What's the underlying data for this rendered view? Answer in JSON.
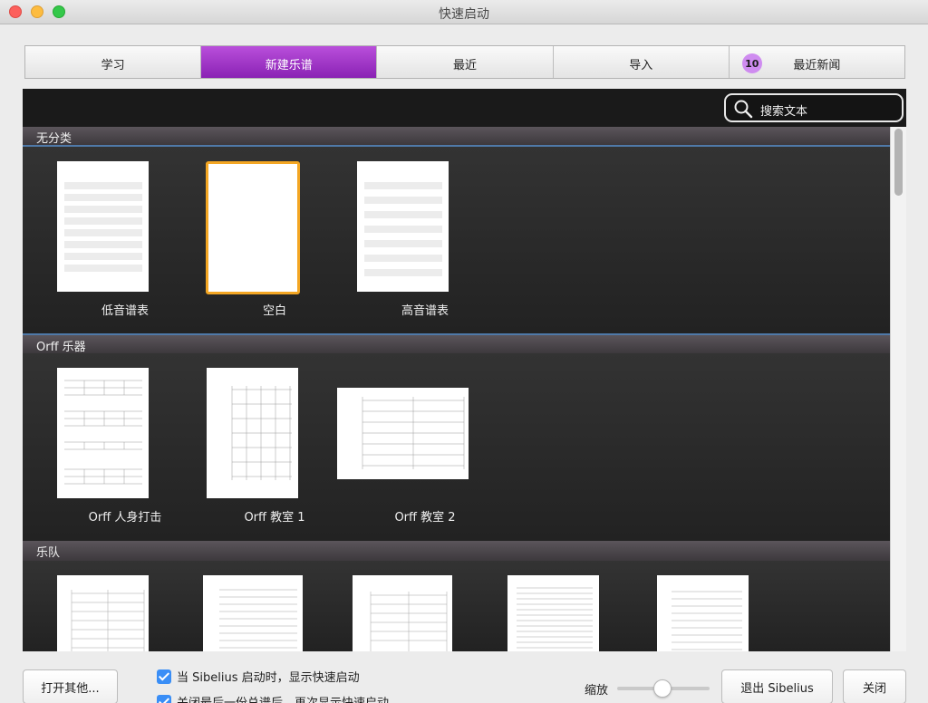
{
  "window": {
    "title": "快速启动"
  },
  "tabs": [
    {
      "label": "学习"
    },
    {
      "label": "新建乐谱"
    },
    {
      "label": "最近"
    },
    {
      "label": "导入"
    },
    {
      "label": "最近新闻",
      "badge": "10"
    }
  ],
  "search": {
    "label": "搜索文本"
  },
  "sections": [
    {
      "title": "无分类",
      "items": [
        {
          "label": "低音谱表"
        },
        {
          "label": "空白"
        },
        {
          "label": "高音谱表"
        }
      ]
    },
    {
      "title": "Orff 乐器",
      "items": [
        {
          "label": "Orff 人身打击"
        },
        {
          "label": "Orff 教室 1"
        },
        {
          "label": "Orff 教室 2"
        }
      ]
    },
    {
      "title": "乐队",
      "items": [
        {},
        {},
        {},
        {},
        {}
      ]
    }
  ],
  "footer": {
    "open_other": "打开其他...",
    "show_on_start": "当 Sibelius 启动时，显示快速启动",
    "show_after_close": "关闭最后一份总谱后，再次显示快速启动",
    "zoom_label": "缩放",
    "quit": "退出 Sibelius",
    "close": "关闭"
  },
  "colors": {
    "active_tab": "#9c2fc6",
    "selection": "#f3a623",
    "checkbox": "#3a8ef6"
  }
}
